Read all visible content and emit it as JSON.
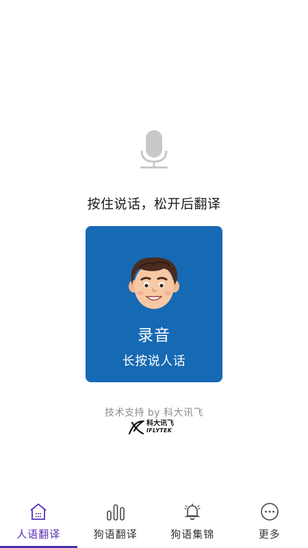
{
  "main": {
    "prompt": "按住说话，松开后翻译",
    "record_card": {
      "title": "录音",
      "subtitle": "长按说人话"
    },
    "support_text": "技术支持 by 科大讯飞",
    "brand": {
      "name_cn": "科大讯飞",
      "name_en": "IFLYTEK"
    },
    "mic_icon": "microphone-icon",
    "avatar_icon": "cartoon-boy-avatar"
  },
  "tabbar": {
    "active_index": 0,
    "accent_color": "#5a2fb5",
    "tabs": [
      {
        "label": "人语翻译",
        "icon": "house-icon"
      },
      {
        "label": "狗语翻译",
        "icon": "bars-icon"
      },
      {
        "label": "狗语集锦",
        "icon": "bell-icon"
      },
      {
        "label": "更多",
        "icon": "more-dots-icon"
      }
    ]
  },
  "colors": {
    "card": "#1669b3",
    "mic": "#c8c8c8",
    "muted_text": "#8c8c8c"
  }
}
